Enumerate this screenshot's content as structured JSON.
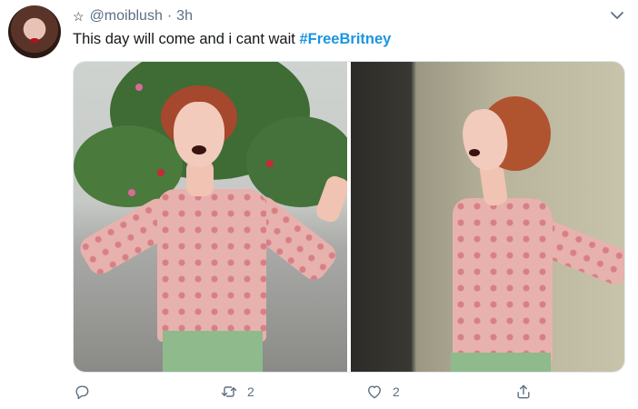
{
  "tweet": {
    "username": "@moiblush",
    "separator": "·",
    "time": "3h",
    "text": "This day will come and i cant wait",
    "hashtag": "#FreeBritney",
    "star_icon": "star-icon",
    "menu_icon": "chevron-down-icon"
  },
  "actions": {
    "reply_icon": "reply-icon",
    "retweet_icon": "retweet-icon",
    "retweet_count": "2",
    "like_icon": "heart-icon",
    "like_count": "2",
    "share_icon": "share-icon"
  },
  "colors": {
    "text": "#14171a",
    "secondary": "#5b7083",
    "hashtag": "#1b95e0"
  }
}
